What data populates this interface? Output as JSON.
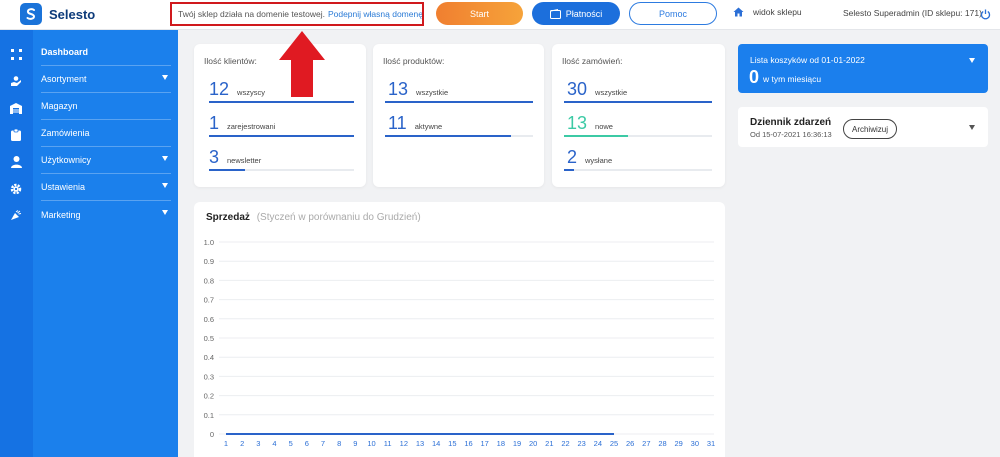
{
  "header": {
    "brand": "Selesto",
    "notice_text": "Twój sklep działa na domenie testowej.",
    "notice_link": "Podepnij własną domenę",
    "start_label": "Start",
    "payments_label": "Płatności",
    "help_label": "Pomoc",
    "shop_view_label": "widok sklepu",
    "admin_info": "Selesto Superadmin (ID sklepu: 171)"
  },
  "sidebar": {
    "items": [
      {
        "label": "Dashboard",
        "icon": "grid-icon",
        "has_submenu": false
      },
      {
        "label": "Asortyment",
        "icon": "hand-icon",
        "has_submenu": true
      },
      {
        "label": "Magazyn",
        "icon": "warehouse-icon",
        "has_submenu": false
      },
      {
        "label": "Zamówienia",
        "icon": "clipboard-icon",
        "has_submenu": false
      },
      {
        "label": "Użytkownicy",
        "icon": "user-icon",
        "has_submenu": true
      },
      {
        "label": "Ustawienia",
        "icon": "gear-icon",
        "has_submenu": true
      },
      {
        "label": "Marketing",
        "icon": "megaphone-icon",
        "has_submenu": true
      }
    ]
  },
  "stats": {
    "clients": {
      "title": "Ilość klientów:",
      "rows": [
        {
          "value": "12",
          "label": "wszyscy",
          "fill": 1.0
        },
        {
          "value": "1",
          "label": "zarejestrowani",
          "fill": 1.0
        },
        {
          "value": "3",
          "label": "newsletter",
          "fill": 0.25
        }
      ]
    },
    "products": {
      "title": "Ilość produktów:",
      "rows": [
        {
          "value": "13",
          "label": "wszystkie",
          "fill": 1.0
        },
        {
          "value": "11",
          "label": "aktywne",
          "fill": 0.85
        }
      ]
    },
    "orders": {
      "title": "Ilość zamówień:",
      "rows": [
        {
          "value": "30",
          "label": "wszystkie",
          "fill": 1.0
        },
        {
          "value": "13",
          "label": "nowe",
          "fill": 0.43
        },
        {
          "value": "2",
          "label": "wysłane",
          "fill": 0.07
        }
      ]
    }
  },
  "carts": {
    "title": "Lista koszyków od 01-01-2022",
    "value": "0",
    "subtitle": "w tym miesiącu"
  },
  "event_log": {
    "title": "Dziennik zdarzeń",
    "subtitle": "Od 15-07-2021 16:36:13",
    "archive_label": "Archiwizuj"
  },
  "sales": {
    "title": "Sprzedaż",
    "subtitle": "(Styczeń w porównaniu do Grudzień)"
  },
  "colors": {
    "accent": "#1b80ec",
    "stat_blue": "#2a63c9",
    "stat_teal": "#3ccaa5",
    "highlight_red": "#d0191d"
  },
  "chart_data": {
    "type": "line",
    "title": "Sprzedaż",
    "subtitle": "(Styczeń w porównaniu do Grudzień)",
    "x": [
      1,
      2,
      3,
      4,
      5,
      6,
      7,
      8,
      9,
      10,
      11,
      12,
      13,
      14,
      15,
      16,
      17,
      18,
      19,
      20,
      21,
      22,
      23,
      24,
      25,
      26,
      27,
      28,
      29,
      30,
      31
    ],
    "ylim": [
      0,
      1.0
    ],
    "yticks": [
      "0",
      "0.1",
      "0.2",
      "0.3",
      "0.4",
      "0.5",
      "0.6",
      "0.7",
      "0.8",
      "0.9",
      "1.0"
    ],
    "series": [
      {
        "values": [
          0,
          0,
          0,
          0,
          0,
          0,
          0,
          0,
          0,
          0,
          0,
          0,
          0,
          0,
          0,
          0,
          0,
          0,
          0,
          0,
          0,
          0,
          0,
          0,
          0,
          null,
          null,
          null,
          null,
          null,
          null
        ]
      }
    ],
    "grid": true
  }
}
